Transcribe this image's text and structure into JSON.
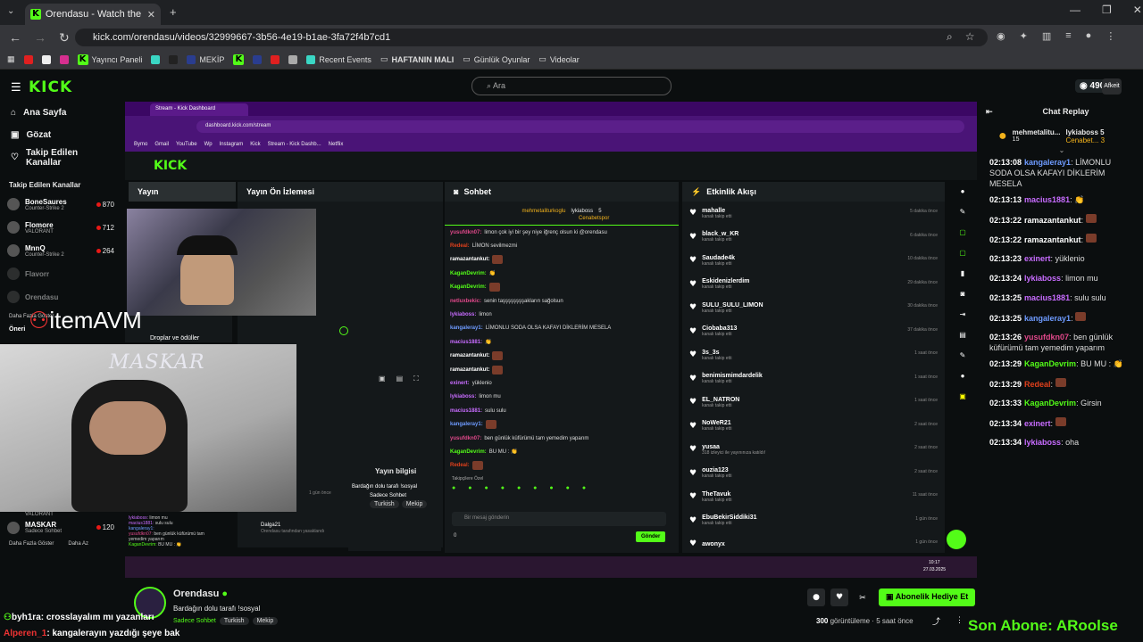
{
  "browser": {
    "tab_title": "Orendasu - Watch the VOD",
    "url": "kick.com/orendasu/videos/32999667-3b56-4e19-b1ae-3fa72f4b7cd1",
    "bookmarks": [
      "Yayıncı Paneli",
      "MEKİP",
      "Recent Events",
      "HAFTANIN MALI",
      "Günlük Oyunlar",
      "Videolar"
    ]
  },
  "header": {
    "logo": "KICK",
    "search_placeholder": "Ara",
    "points": "490",
    "avatar_text": "Afkeit"
  },
  "sidebar": {
    "nav": [
      "Ana Sayfa",
      "Gözat",
      "Takip Edilen Kanallar"
    ],
    "section_title": "Takip Edilen Kanallar",
    "channels": [
      {
        "name": "BoneSaures",
        "game": "Counter-Strike 2",
        "viewers": "870"
      },
      {
        "name": "Flomore",
        "game": "VALORANT",
        "viewers": "712"
      },
      {
        "name": "MnnQ",
        "game": "Counter-Strike 2",
        "viewers": "264"
      },
      {
        "name": "Flavorr",
        "game": "",
        "viewers": ""
      },
      {
        "name": "Orendasu",
        "game": "",
        "viewers": ""
      }
    ],
    "show_more": "Daha Fazla Göster",
    "recommended_partial": "Öneri",
    "bottom_channel": {
      "name": "MASKAR",
      "game": "Sadece Sohbet",
      "viewers": "120",
      "game_above": "VALORANT"
    },
    "show_more2": "Daha Fazla Göster",
    "show_less": "Daha Az",
    "overlay_brand": "itemAVM"
  },
  "dashboard": {
    "tab": "Stream - Kick Dashboard",
    "url": "dashboard.kick.com/stream",
    "bookmarks": [
      "Bymo",
      "Gmail",
      "YouTube",
      "Wp",
      "Instagram",
      "Kick",
      "Stream - Kick Dashb...",
      "Netflix"
    ],
    "panels": {
      "yayin": "Yayın",
      "preview": "Yayın Ön İzlemesi",
      "chat": "Sohbet",
      "activity": "Etkinlik Akışı",
      "drops": "Droplar ve ödüller",
      "stream_info": "Yayın bilgisi",
      "stream_title": "Bardağın dolu tarafı !sosyal",
      "tags": [
        "Sadece Sohbet",
        "Turkish",
        "Mekip"
      ]
    },
    "pinned": {
      "user1": "mehmetaliturkoglu",
      "user2": "lykiaboss",
      "user2_count": "5",
      "user3": "Cenabetspor",
      "user3_count": "3"
    },
    "chat_messages": [
      {
        "user": "yusufdkn07",
        "text": "limon çok iyi bir şey niye iğrenç olsun ki @orendasu"
      },
      {
        "user": "Redeal",
        "text": "LİMON sevilmezmi"
      },
      {
        "user": "ramazantankut",
        "text": ""
      },
      {
        "user": "KaganDevrim",
        "text": "👏"
      },
      {
        "user": "KaganDevrim",
        "text": ""
      },
      {
        "user": "netluxbekic",
        "text": "senin taşşşşşşşşakların sağolsun"
      },
      {
        "user": "lykiaboss",
        "text": "limon"
      },
      {
        "user": "kangaleray1",
        "text": "LİMONLU SODA OLSA KAFAYI DİKLERİM MESELA"
      },
      {
        "user": "macius1881",
        "text": "👏"
      },
      {
        "user": "ramazantankut",
        "text": ""
      },
      {
        "user": "ramazantankut",
        "text": ""
      },
      {
        "user": "exinert",
        "text": "yüklenio"
      },
      {
        "user": "lykiaboss",
        "text": "limon mu"
      },
      {
        "user": "macius1881",
        "text": "sulu sulu"
      },
      {
        "user": "kangaleray1",
        "text": ""
      },
      {
        "user": "yusufdkn07",
        "text": "ben günlük küfürümü tam yemedim yaparım"
      },
      {
        "user": "KaganDevrim",
        "text": "BU MU : 👏"
      },
      {
        "user": "Redeal",
        "text": ""
      }
    ],
    "followers_label": "Takipçilere Özel",
    "chat_input_placeholder": "Bir mesaj gönderin",
    "send_label": "Gönder",
    "chat_count": "0",
    "events": [
      {
        "name": "mahalle",
        "sub": "kanalı takip etti",
        "time": "5 dakika önce"
      },
      {
        "name": "black_w_KR",
        "sub": "kanalı takip etti",
        "time": "6 dakika önce"
      },
      {
        "name": "Saudade4k",
        "sub": "kanalı takip etti",
        "time": "10 dakika önce"
      },
      {
        "name": "Eskidenizlerdim",
        "sub": "kanalı takip etti",
        "time": "29 dakika önce"
      },
      {
        "name": "SULU_SULU_LIMON",
        "sub": "kanalı takip etti",
        "time": "30 dakika önce"
      },
      {
        "name": "Ciobaba313",
        "sub": "kanalı takip etti",
        "time": "37 dakika önce"
      },
      {
        "name": "3s_3s",
        "sub": "kanalı takip etti",
        "time": "1 saat önce"
      },
      {
        "name": "benimismimdardelik",
        "sub": "kanalı takip etti",
        "time": "1 saat önce"
      },
      {
        "name": "EL_NATRON",
        "sub": "kanalı takip etti",
        "time": "1 saat önce"
      },
      {
        "name": "NoWeR21",
        "sub": "kanalı takip etti",
        "time": "2 saat önce"
      },
      {
        "name": "yusaa",
        "sub": "318 izleyici ile yayınınıza katıldı!",
        "time": "2 saat önce"
      },
      {
        "name": "ouzia123",
        "sub": "kanalı takip etti",
        "time": "2 saat önce"
      },
      {
        "name": "TheTavuk",
        "sub": "kanalı takip etti",
        "time": "11 saat önce"
      },
      {
        "name": "EbuBekirSiddiki31",
        "sub": "kanalı takip etti",
        "time": "1 gün önce"
      },
      {
        "name": "awonyx",
        "sub": "",
        "time": "1 gün önce"
      }
    ],
    "bottom_chat_preview": [
      {
        "user": "lykiaboss",
        "text": "limon mu"
      },
      {
        "user": "macius1881",
        "text": "sulu sulu"
      },
      {
        "user": "kangaleray1",
        "text": ""
      },
      {
        "user": "yusufdkn07",
        "text": "ben günlük küfürümü tam yemedim yaparım"
      },
      {
        "user": "KaganDevrim",
        "text": "BU MU : 👏"
      }
    ],
    "mid_entries": [
      {
        "text": "1 gün önce"
      },
      {
        "text": "Dalga21",
        "sub": "Orendasu tarafından yasaklandı",
        "time": "1 gün önce"
      }
    ],
    "taskbar_time": "10:17",
    "taskbar_date": "27.03.2025",
    "cam_overlay_text": "MASKAR"
  },
  "chat_replay": {
    "title": "Chat Replay",
    "pinned": {
      "user1": "mehmetalitu...",
      "user1_count": "15",
      "user2": "lykiaboss",
      "user2_count": "5",
      "user3": "Cenabet...",
      "user3_count": "3"
    },
    "messages": [
      {
        "time": "02:13:08",
        "user": "kangaleray1",
        "color": "#6e9bff",
        "text": "LİMONLU SODA OLSA KAFAYI DİKLERİM MESELA"
      },
      {
        "time": "02:13:13",
        "user": "macius1881",
        "color": "#c86cff",
        "text": "👏"
      },
      {
        "time": "02:13:22",
        "user": "ramazantankut",
        "color": "#ffffff",
        "text": ""
      },
      {
        "time": "02:13:22",
        "user": "ramazantankut",
        "color": "#ffffff",
        "text": ""
      },
      {
        "time": "02:13:23",
        "user": "exinert",
        "color": "#c86cff",
        "text": "yüklenio"
      },
      {
        "time": "02:13:24",
        "user": "lykiaboss",
        "color": "#c86cff",
        "text": "limon mu"
      },
      {
        "time": "02:13:25",
        "user": "macius1881",
        "color": "#c86cff",
        "text": "sulu sulu"
      },
      {
        "time": "02:13:25",
        "user": "kangaleray1",
        "color": "#6e9bff",
        "text": ""
      },
      {
        "time": "02:13:26",
        "user": "yusufdkn07",
        "color": "#e0488a",
        "text": "ben günlük küfürümü tam yemedim yaparım"
      },
      {
        "time": "02:13:29",
        "user": "KaganDevrim",
        "color": "#53fc18",
        "text": "BU MU : 👏"
      },
      {
        "time": "02:13:29",
        "user": "Redeal",
        "color": "#e0401c",
        "text": ""
      },
      {
        "time": "02:13:33",
        "user": "KaganDevrim",
        "color": "#53fc18",
        "text": "Girsin"
      },
      {
        "time": "02:13:34",
        "user": "exinert",
        "color": "#c86cff",
        "text": ""
      },
      {
        "time": "02:13:34",
        "user": "lykiaboss",
        "color": "#c86cff",
        "text": "oha"
      }
    ]
  },
  "channel_info": {
    "name": "Orendasu",
    "title": "Bardağın dolu tarafı !sosyal",
    "category": "Sadece Sohbet",
    "tags": [
      "Turkish",
      "Mekip"
    ],
    "views": "300",
    "views_label": "görüntüleme",
    "ago": "5 saat önce",
    "subscribe_gift": "Abonelik Hediye Et"
  },
  "overlays": {
    "line1_user": "byh1ra",
    "line1_text": "crosslayalım mı yazanları",
    "line2_user": "Alperen_1",
    "line2_text": "kangalerayın yazdığı şeye bak",
    "last_sub": "Son Abone: ARoolse"
  },
  "colors": {
    "kick_green": "#53fc18",
    "background": "#0b0e0f",
    "dashboard_purple": "#4a1477"
  }
}
